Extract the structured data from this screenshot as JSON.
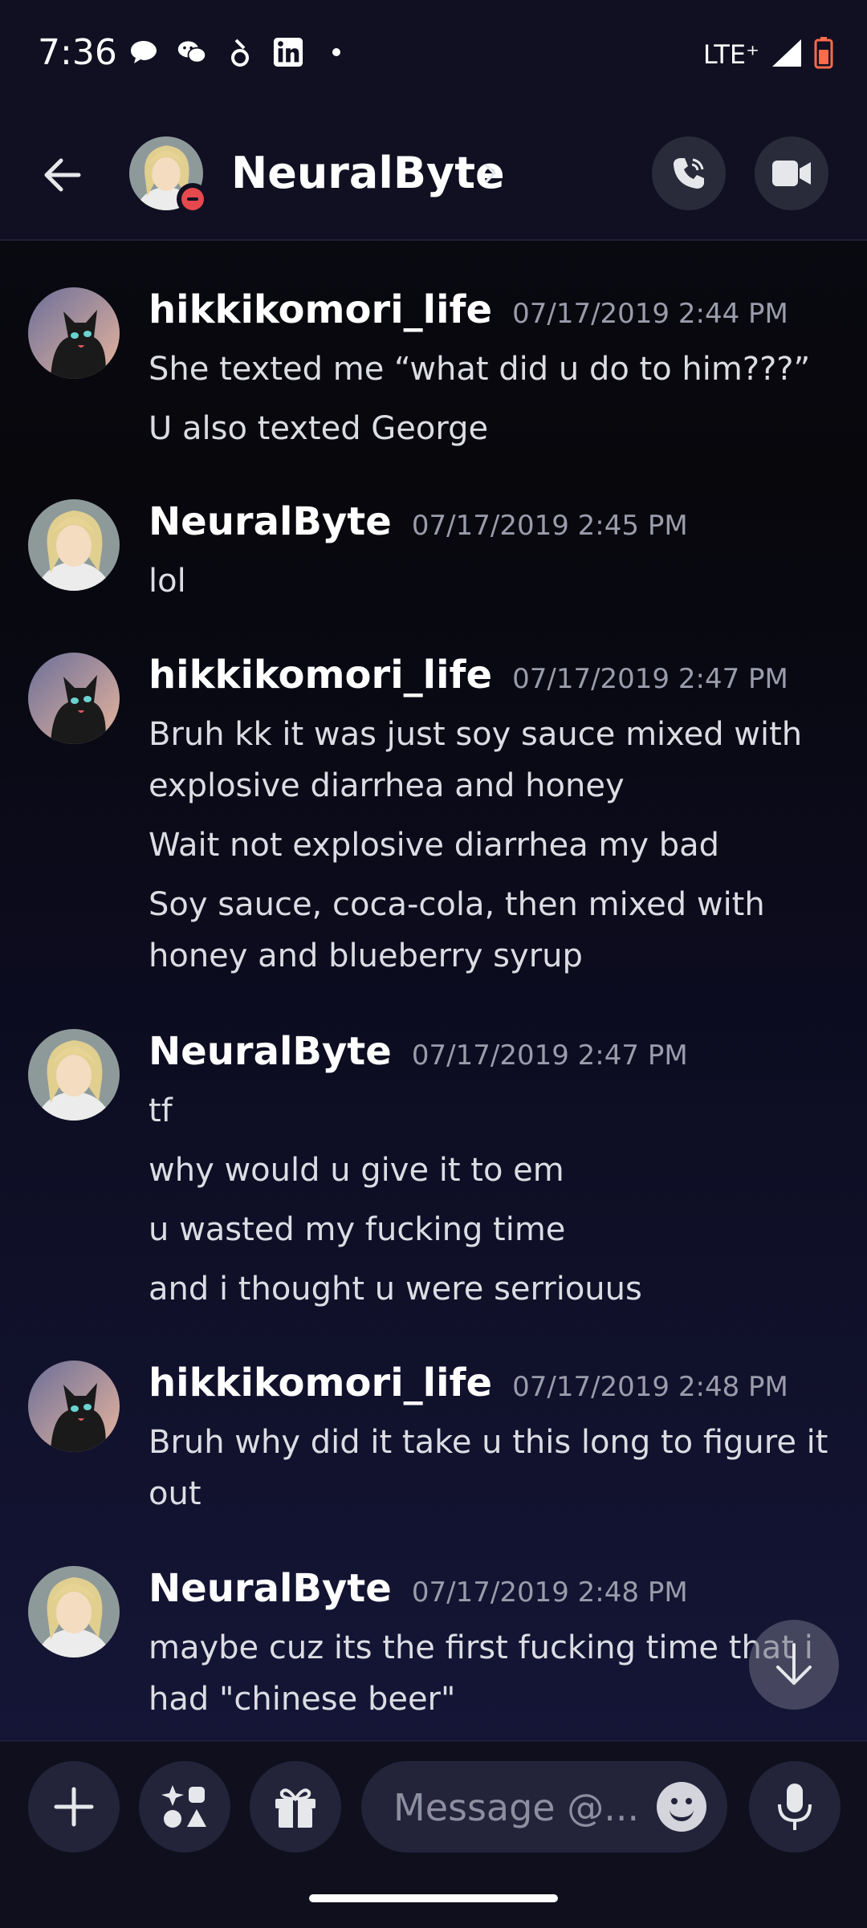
{
  "status": {
    "time": "7:36",
    "network": "LTE⁺"
  },
  "header": {
    "title": "NeuralByte"
  },
  "messages": [
    {
      "author": "hikkikomori_life",
      "timestamp": "07/17/2019 2:44 PM",
      "avatar": "cat-avatar",
      "lines": [
        "She texted me “what did u do to him???”",
        "U also texted George"
      ]
    },
    {
      "author": "NeuralByte",
      "timestamp": "07/17/2019 2:45 PM",
      "avatar": "blond-anime-avatar",
      "lines": [
        "lol"
      ]
    },
    {
      "author": "hikkikomori_life",
      "timestamp": "07/17/2019 2:47 PM",
      "avatar": "cat-avatar",
      "lines": [
        "Bruh kk it was just soy sauce mixed with explosive diarrhea and honey",
        "Wait not explosive diarrhea my bad",
        "Soy sauce, coca-cola, then mixed with honey and blueberry syrup"
      ]
    },
    {
      "author": "NeuralByte",
      "timestamp": "07/17/2019 2:47 PM",
      "avatar": "blond-anime-avatar",
      "lines": [
        "tf",
        "why would u give it to em",
        "u wasted my fucking time",
        "and i thought u were serriouus"
      ]
    },
    {
      "author": "hikkikomori_life",
      "timestamp": "07/17/2019 2:48 PM",
      "avatar": "cat-avatar",
      "lines": [
        "Bruh why did it take u this long to figure it out"
      ]
    },
    {
      "author": "NeuralByte",
      "timestamp": "07/17/2019 2:48 PM",
      "avatar": "blond-anime-avatar",
      "lines": [
        "maybe cuz its the first fucking time that i had \"chinese beer\""
      ]
    }
  ],
  "composer": {
    "placeholder": "Message @..."
  },
  "colors": {
    "background": "#0b0b14",
    "header": "#101022",
    "button": "#23243a",
    "dnd": "#e5484d"
  },
  "icons": [
    "chat-bubble-icon",
    "wechat-icon",
    "wallet-icon",
    "linkedin-icon",
    "signal-icon",
    "battery-icon",
    "back-arrow-icon",
    "phone-icon",
    "video-icon",
    "plus-icon",
    "apps-icon",
    "gift-icon",
    "emoji-icon",
    "microphone-icon",
    "arrow-down-icon"
  ]
}
